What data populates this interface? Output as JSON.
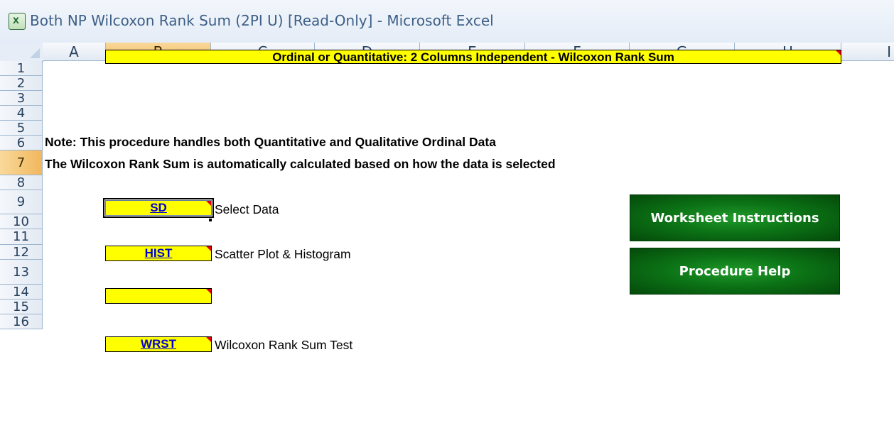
{
  "window": {
    "title": "Both NP Wilcoxon Rank Sum (2PI U)  [Read-Only] - Microsoft Excel",
    "app_icon": "excel-icon"
  },
  "columns": [
    "A",
    "B",
    "C",
    "D",
    "E",
    "F",
    "G",
    "H",
    "I"
  ],
  "rows": [
    "1",
    "2",
    "3",
    "4",
    "5",
    "6",
    "7",
    "8",
    "9",
    "10",
    "11",
    "12",
    "13",
    "14",
    "15",
    "16"
  ],
  "selected_column": "B",
  "selected_row": "7",
  "sheet": {
    "title": "Ordinal or Quantitative: 2 Columns Independent - Wilcoxon Rank Sum",
    "note1": "Note: This procedure handles both Quantitative and Qualitative Ordinal Data",
    "note2": "The Wilcoxon Rank Sum is automatically calculated based on how the data is selected"
  },
  "macros": [
    {
      "code": "SD",
      "label": "Select Data"
    },
    {
      "code": "HIST",
      "label": "Scatter Plot & Histogram"
    },
    {
      "code": "",
      "label": ""
    },
    {
      "code": "WRST",
      "label": "Wilcoxon Rank Sum Test"
    }
  ],
  "buttons": {
    "instructions": "Worksheet Instructions",
    "help": "Procedure Help"
  },
  "colors": {
    "cell_fill": "#ffff00",
    "link": "#0000d0",
    "button_green": "#0c7416",
    "comment_marker": "#e00000"
  }
}
